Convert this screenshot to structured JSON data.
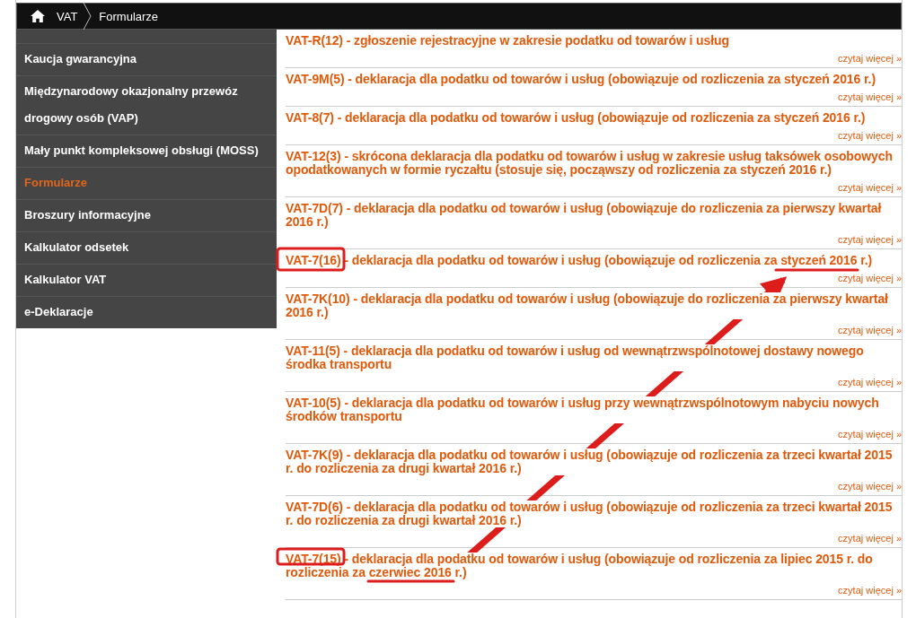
{
  "breadcrumb": [
    {
      "label": "VAT"
    },
    {
      "label": "Formularze"
    }
  ],
  "sidebar": {
    "items": [
      {
        "label": "Kaucja gwarancyjna",
        "selected": false
      },
      {
        "label": "Międzynarodowy okazjonalny przewóz drogowy osób (VAP)",
        "selected": false
      },
      {
        "label": "Mały punkt kompleksowej obsługi (MOSS)",
        "selected": false
      },
      {
        "label": "Formularze",
        "selected": true
      },
      {
        "label": "Broszury informacyjne",
        "selected": false
      },
      {
        "label": "Kalkulator odsetek",
        "selected": false
      },
      {
        "label": "Kalkulator VAT",
        "selected": false
      },
      {
        "label": "e-Deklaracje",
        "selected": false
      }
    ]
  },
  "forms": [
    {
      "title": "VAT-R(12) - zgłoszenie rejestracyjne w zakresie podatku od towarów i usług",
      "more": "czytaj więcej »"
    },
    {
      "title": "VAT-9M(5) - deklaracja dla podatku od towarów i usług (obowiązuje od rozliczenia za styczeń 2016 r.)",
      "more": "czytaj więcej »"
    },
    {
      "title": "VAT-8(7) - deklaracja dla podatku od towarów i usług (obowiązuje od rozliczenia za styczeń 2016 r.)",
      "more": "czytaj więcej »"
    },
    {
      "title": "VAT-12(3) - skrócona deklaracja dla podatku od towarów i usług w zakresie usług taksówek osobowych opodatkowanych w formie ryczałtu (stosuje się, począwszy od rozliczenia za styczeń 2016 r.)",
      "more": "czytaj więcej »"
    },
    {
      "title": "VAT-7D(7) - deklaracja dla podatku od towarów i usług (obowiązuje do rozliczenia za pierwszy kwartał 2016 r.)",
      "more": "czytaj więcej »"
    },
    {
      "title": "VAT-7(16) - deklaracja dla podatku od towarów i usług (obowiązuje od rozliczenia za styczeń 2016 r.)",
      "more": "czytaj więcej »"
    },
    {
      "title": "VAT-7K(10) - deklaracja dla podatku od towarów i usług (obowiązuje do rozliczenia za pierwszy kwartał 2016 r.)",
      "more": "czytaj więcej »"
    },
    {
      "title": "VAT-11(5) - deklaracja dla podatku od towarów i usług od wewnątrzwspólnotowej dostawy nowego środka transportu",
      "more": "czytaj więcej »"
    },
    {
      "title": "VAT-10(5) - deklaracja dla podatku od towarów i usług przy wewnątrzwspólnotowym nabyciu nowych środków transportu",
      "more": "czytaj więcej »"
    },
    {
      "title": "VAT-7K(9) - deklaracja dla podatku od towarów i usług (obowiązuje od rozliczenia za trzeci kwartał 2015 r. do rozliczenia za drugi kwartał 2016 r.)",
      "more": "czytaj więcej »"
    },
    {
      "title": "VAT-7D(6) - deklaracja dla podatku od towarów i usług (obowiązuje od rozliczenia za trzeci kwartał 2015 r. do rozliczenia za drugi kwartał 2016 r.)",
      "more": "czytaj więcej »"
    },
    {
      "title": "VAT-7(15) - deklaracja dla podatku od towarów i usług (obowiązuje od rozliczenia za lipiec 2015 r. do rozliczenia za czerwiec 2016 r.)",
      "more": "czytaj więcej »"
    }
  ],
  "annotations": [
    {
      "kind": "box"
    },
    {
      "kind": "underline"
    },
    {
      "kind": "arrow"
    },
    {
      "kind": "box"
    },
    {
      "kind": "underline"
    }
  ]
}
